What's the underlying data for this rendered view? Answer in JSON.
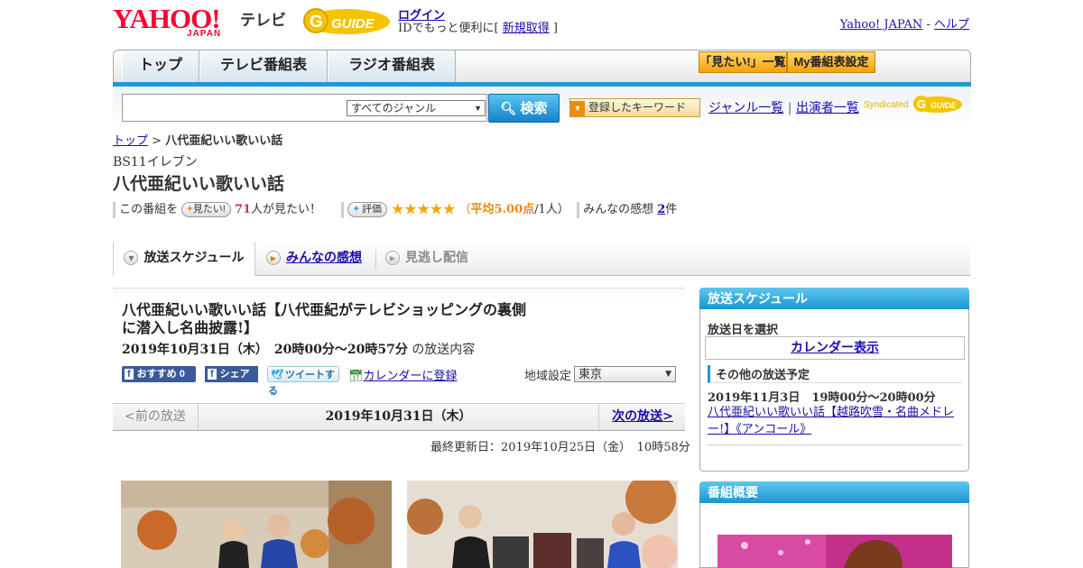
{
  "header": {
    "logo_main": "YAHOO!",
    "logo_sub": "JAPAN",
    "service": "テレビ",
    "gguide_logo": "G GUIDE",
    "login": "ログイン",
    "id_text_pre": "IDでもっと便利に[ ",
    "signup": "新規取得",
    "id_text_post": " ]",
    "yahoo_japan": "Yahoo! JAPAN",
    "sep": " - ",
    "help": "ヘルプ"
  },
  "nav": {
    "tabs": [
      "トップ",
      "テレビ番組表",
      "ラジオ番組表"
    ],
    "mitai_list": "「見たい!」一覧",
    "my_bangumi": "My番組表設定"
  },
  "search": {
    "placeholder": "",
    "genre_selected": "すべてのジャンル",
    "button": "検索",
    "keyword_btn": "登録したキーワード",
    "genre_list": "ジャンル一覧",
    "divider": "|",
    "performers": "出演者一覧",
    "syndicated": "Syndicated"
  },
  "breadcrumb": {
    "top": "トップ",
    "sep": " > ",
    "current": "八代亜紀いい歌いい話"
  },
  "program": {
    "channel": "BS11イレブン",
    "title": "八代亜紀いい歌いい話",
    "mitai_pre": "この番組を",
    "mitai_btn": "見たい!",
    "mitai_count": "71",
    "mitai_post": "人が見たい！",
    "rate_btn": "評価",
    "stars": "★★★★★",
    "avg_open": "（",
    "avg_label": "平均5.00点",
    "avg_count": "/1人）",
    "kanso_label": "みんなの感想",
    "kanso_count": "2",
    "kanso_unit": "件",
    "rating": 5.0
  },
  "tabs": [
    {
      "label": "放送スケジュール",
      "active": true
    },
    {
      "label": "みんなの感想",
      "active": false
    },
    {
      "label": "見逃し配信",
      "active": false
    }
  ],
  "episode": {
    "title": "八代亜紀いい歌いい話【八代亜紀がテレビショッピングの裏側に潜入し名曲披露!】",
    "date": "2019年10月31日（木）　20時00分～20時57分",
    "date_suffix": "の放送内容",
    "fb_recommend": "おすすめ 0",
    "fb_share": "シェア",
    "tweet": "ツイートする",
    "calendar": "カレンダーに登録",
    "region_label": "地域設定",
    "region_value": "東京",
    "prev": "<前の放送",
    "current": "2019年10月31日（木）",
    "next": "次の放送>",
    "updated": "最終更新日：2019年10月25日（金）　10時58分"
  },
  "sidebar": {
    "schedule_head": "放送スケジュール",
    "select_date": "放送日を選択",
    "calendar": "カレンダー表示",
    "other_head": "その他の放送予定",
    "other_date": "2019年11月3日　19時00分～20時00分",
    "other_title": "八代亜紀いい歌いい話【越路吹雪・名曲メドレー!】《アンコール》",
    "overview_head": "番組概要"
  },
  "colors": {
    "accent": "#1a9bd7",
    "star": "#f0a800",
    "pink": "#c0356e",
    "link": "#1a0dab"
  }
}
